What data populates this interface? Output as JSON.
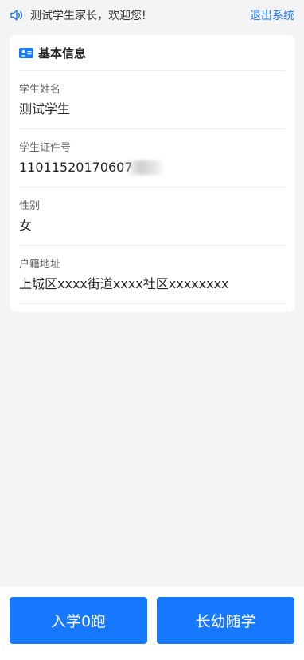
{
  "header": {
    "welcome": "测试学生家长，欢迎您!",
    "logout_label": "退出系统"
  },
  "card": {
    "title": "基本信息",
    "fields": [
      {
        "label": "学生姓名",
        "value": "测试学生"
      },
      {
        "label": "学生证件号",
        "value": "11011520170607"
      },
      {
        "label": "性别",
        "value": "女"
      },
      {
        "label": "户籍地址",
        "value": "上城区xxxx街道xxxx社区xxxxxxxx"
      }
    ]
  },
  "actions": {
    "primary_label": "入学0跑",
    "secondary_label": "长幼随学"
  },
  "colors": {
    "accent": "#1677ff",
    "background": "#f4f4f4"
  }
}
